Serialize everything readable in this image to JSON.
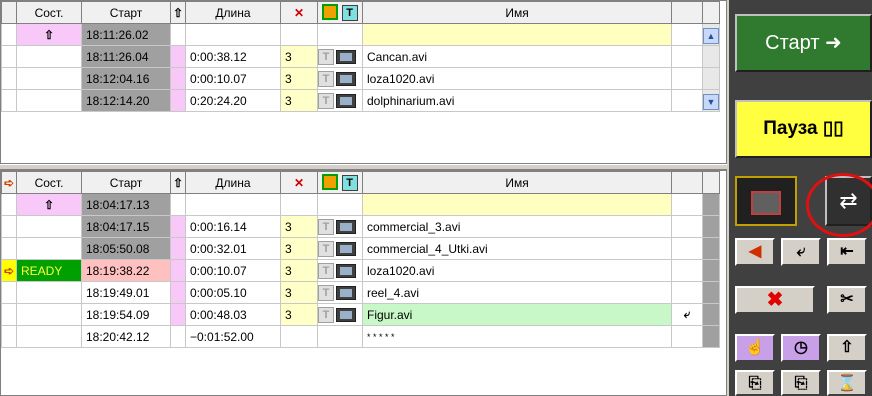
{
  "top_table": {
    "headers": {
      "state": "Сост.",
      "start": "Старт",
      "length": "Длина",
      "name": "Имя",
      "flag_t": "T"
    },
    "rows": [
      {
        "state": "",
        "start": "18:11:26.02",
        "length": "",
        "trans": "",
        "name": ""
      },
      {
        "state": "",
        "start": "18:11:26.04",
        "length": "0:00:38.12",
        "trans": "3",
        "name": "Cancan.avi"
      },
      {
        "state": "",
        "start": "18:12:04.16",
        "length": "0:00:10.07",
        "trans": "3",
        "name": "loza1020.avi"
      },
      {
        "state": "",
        "start": "18:12:14.20",
        "length": "0:20:24.20",
        "trans": "3",
        "name": "dolphinarium.avi"
      }
    ]
  },
  "bottom_table": {
    "headers": {
      "state": "Сост.",
      "start": "Старт",
      "length": "Длина",
      "name": "Имя",
      "flag_t": "T"
    },
    "rows": [
      {
        "state": "",
        "start": "18:04:17.13",
        "length": "",
        "trans": "",
        "name": ""
      },
      {
        "state": "",
        "start": "18:04:17.15",
        "length": "0:00:16.14",
        "trans": "3",
        "name": "commercial_3.avi"
      },
      {
        "state": "",
        "start": "18:05:50.08",
        "length": "0:00:32.01",
        "trans": "3",
        "name": "commercial_4_Utki.avi"
      },
      {
        "state": "READY",
        "start": "18:19:38.22",
        "length": "0:00:10.07",
        "trans": "3",
        "name": "loza1020.avi"
      },
      {
        "state": "",
        "start": "18:19:49.01",
        "length": "0:00:05.10",
        "trans": "3",
        "name": "reel_4.avi"
      },
      {
        "state": "",
        "start": "18:19:54.09",
        "length": "0:00:48.03",
        "trans": "3",
        "name": "Figur.avi"
      },
      {
        "state": "",
        "start": "18:20:42.12",
        "length": "−0:01:52.00",
        "trans": "",
        "name": "* * * * *"
      }
    ]
  },
  "controls": {
    "start_label": "Старт ➜",
    "pause_label": "Пауза ▯▯",
    "swap_icon": "⇄",
    "t_glyph": "T"
  },
  "colors": {
    "start_button": "#2f7a2f",
    "pause_button": "#ffff40",
    "ready_state": "#00a000",
    "highlight_ring": "#e01010"
  }
}
